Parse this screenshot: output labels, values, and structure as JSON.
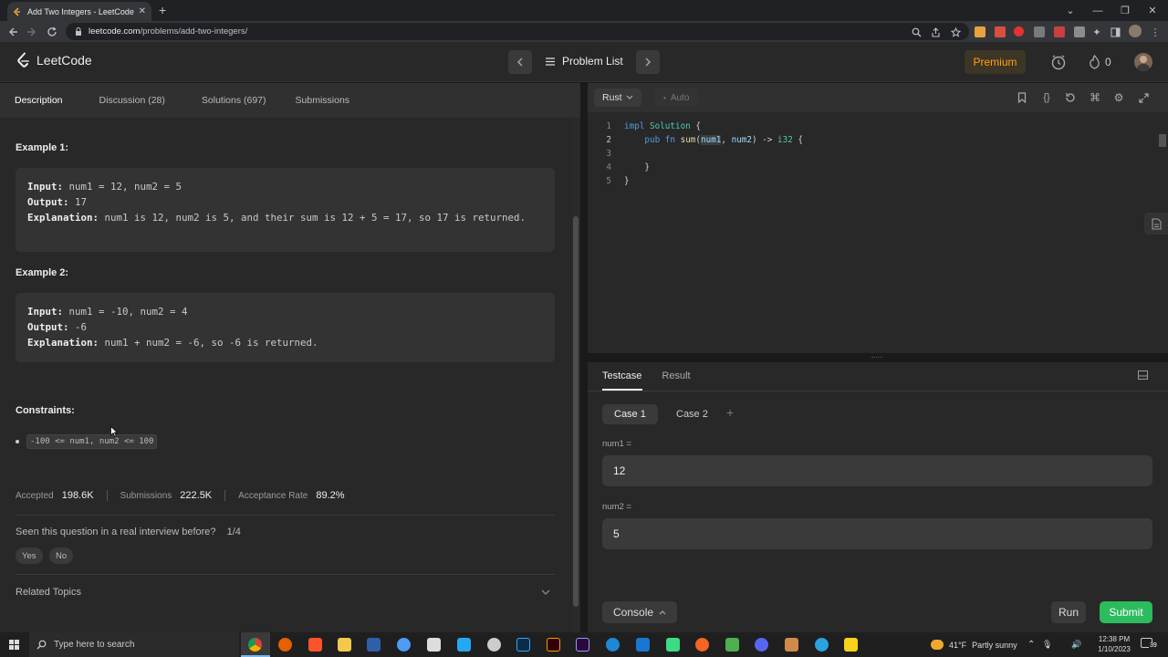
{
  "browser": {
    "tab_title": "Add Two Integers - LeetCode",
    "url_host": "leetcode.com",
    "url_path": "/problems/add-two-integers/"
  },
  "header": {
    "brand": "LeetCode",
    "problem_list": "Problem List",
    "premium": "Premium",
    "streak_count": "0"
  },
  "left_tabs": [
    {
      "label": "Description"
    },
    {
      "label": "Discussion (28)"
    },
    {
      "label": "Solutions (697)"
    },
    {
      "label": "Submissions"
    }
  ],
  "examples": [
    {
      "heading": "Example 1:",
      "input_label": "Input:",
      "input": "num1 = 12, num2 = 5",
      "output_label": "Output:",
      "output": "17",
      "explanation_label": "Explanation:",
      "explanation": "num1 is 12, num2 is 5, and their sum is 12 + 5 = 17, so 17 is returned."
    },
    {
      "heading": "Example 2:",
      "input_label": "Input:",
      "input": "num1 = -10, num2 = 4",
      "output_label": "Output:",
      "output": "-6",
      "explanation_label": "Explanation:",
      "explanation": "num1 + num2 = -6, so -6 is returned."
    }
  ],
  "constraints": {
    "heading": "Constraints:",
    "items": [
      "-100 <= num1, num2 <= 100"
    ]
  },
  "stats": {
    "accepted_label": "Accepted",
    "accepted": "198.6K",
    "submissions_label": "Submissions",
    "submissions": "222.5K",
    "rate_label": "Acceptance Rate",
    "rate": "89.2%"
  },
  "interview": {
    "question": "Seen this question in a real interview before?",
    "count": "1/4",
    "yes": "Yes",
    "no": "No"
  },
  "related_topics": "Related Topics",
  "editor": {
    "language": "Rust",
    "mode": "Auto",
    "line_numbers": [
      "1",
      "2",
      "3",
      "4",
      "5"
    ],
    "lines": [
      "impl Solution {",
      "    pub fn sum(num1, num2) -> i32 {",
      "",
      "    }",
      "}"
    ]
  },
  "testcase": {
    "tabs": [
      "Testcase",
      "Result"
    ],
    "cases": [
      "Case 1",
      "Case 2"
    ],
    "add": "+",
    "fields": [
      {
        "label": "num1 =",
        "value": "12"
      },
      {
        "label": "num2 =",
        "value": "5"
      }
    ],
    "console": "Console",
    "run": "Run",
    "submit": "Submit"
  },
  "taskbar": {
    "search_placeholder": "Type here to search",
    "weather": "41°F",
    "weather_desc": "Partly sunny",
    "time": "12:38 PM",
    "date": "1/10/2023",
    "notif_count": "39"
  },
  "colors": {
    "accent_orange": "#ffa116",
    "submit_green": "#2cbb5d"
  }
}
